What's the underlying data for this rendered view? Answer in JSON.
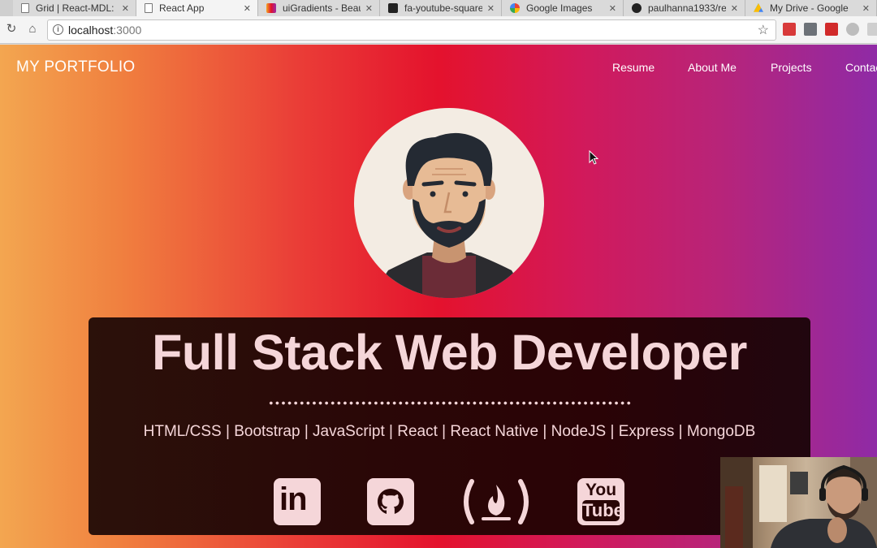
{
  "browser": {
    "tabs": [
      {
        "title": "Grid | React-MDL:",
        "favicon": "document-icon",
        "active": false
      },
      {
        "title": "React App",
        "favicon": "document-icon",
        "active": true
      },
      {
        "title": "uiGradients - Beau",
        "favicon": "gradient-icon",
        "active": false
      },
      {
        "title": "fa-youtube-square",
        "favicon": "youtube-square-icon",
        "active": false
      },
      {
        "title": "Google Images",
        "favicon": "google-icon",
        "active": false
      },
      {
        "title": "paulhanna1933/rea",
        "favicon": "github-icon",
        "active": false
      },
      {
        "title": "My Drive - Google",
        "favicon": "drive-icon",
        "active": false
      }
    ],
    "url_host": "localhost",
    "url_port": ":3000"
  },
  "page": {
    "brand": "MY PORTFOLIO",
    "nav": [
      "Resume",
      "About Me",
      "Projects",
      "Contac"
    ],
    "headline": "Full Stack Web Developer",
    "skills": "HTML/CSS | Bootstrap | JavaScript | React | React Native | NodeJS | Express | MongoDB",
    "social": [
      {
        "icon": "linkedin-icon",
        "text": "in"
      },
      {
        "icon": "github-icon"
      },
      {
        "icon": "freecodecamp-icon"
      },
      {
        "icon": "youtube-icon",
        "text_top": "You",
        "text_bottom": "Tube"
      }
    ],
    "colors": {
      "gradient_left": "#f3a650",
      "gradient_mid": "#e4122d",
      "gradient_right": "#8f2aa6",
      "banner_bg": "#2a0707",
      "banner_text": "#f5d6d9"
    }
  }
}
